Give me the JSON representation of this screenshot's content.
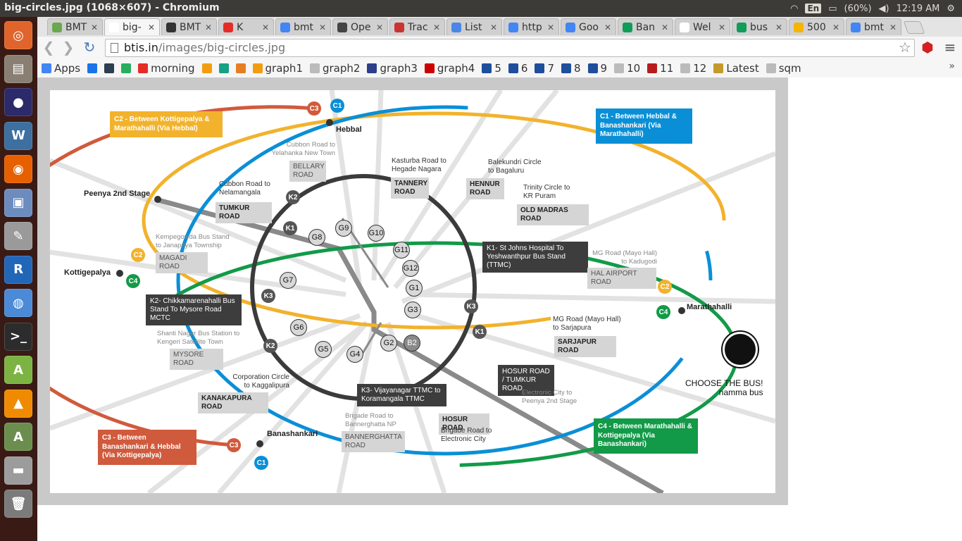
{
  "window": {
    "title": "big-circles.jpg (1068×607) - Chromium",
    "tray": {
      "lang": "En",
      "battery": "(60%)",
      "time": "12:19 AM"
    }
  },
  "launcher": {
    "items": [
      {
        "name": "ubuntu",
        "glyph": "◎",
        "color": "#e0642b"
      },
      {
        "name": "files",
        "glyph": "▤",
        "color": "#8a7f73"
      },
      {
        "name": "eclipse",
        "glyph": "●",
        "color": "#2c2a6b"
      },
      {
        "name": "mysql-workbench",
        "glyph": "W",
        "color": "#3d6fa0"
      },
      {
        "name": "firefox",
        "glyph": "◉",
        "color": "#e66000"
      },
      {
        "name": "image-viewer",
        "glyph": "▣",
        "color": "#6c8cbf"
      },
      {
        "name": "text-editor",
        "glyph": "✎",
        "color": "#9a9a9a"
      },
      {
        "name": "r",
        "glyph": "R",
        "color": "#2266b8"
      },
      {
        "name": "chromium",
        "glyph": "◍",
        "color": "#4a8ad6"
      },
      {
        "name": "terminal",
        "glyph": ">_",
        "color": "#2c2c2c"
      },
      {
        "name": "android-studio",
        "glyph": "A",
        "color": "#7cb342"
      },
      {
        "name": "vlc",
        "glyph": "▲",
        "color": "#f08a00"
      },
      {
        "name": "software-updater",
        "glyph": "A",
        "color": "#6b8e4e"
      },
      {
        "name": "disk",
        "glyph": "▬",
        "color": "#9c9c9c"
      },
      {
        "name": "trash",
        "glyph": "🗑",
        "color": "#7b7b7b"
      }
    ]
  },
  "browser": {
    "tabs": [
      {
        "label": "BMT",
        "fav": "#6aa84f",
        "active": false
      },
      {
        "label": "big-",
        "fav": "#ffffff",
        "active": true
      },
      {
        "label": "BMT",
        "fav": "#333333",
        "active": false
      },
      {
        "label": "K",
        "fav": "#e52d27",
        "active": false
      },
      {
        "label": "bmt",
        "fav": "#4285f4",
        "active": false
      },
      {
        "label": "Ope",
        "fav": "#444444",
        "active": false
      },
      {
        "label": "Trac",
        "fav": "#cc3333",
        "active": false
      },
      {
        "label": "List",
        "fav": "#4a86e8",
        "active": false
      },
      {
        "label": "http",
        "fav": "#4285f4",
        "active": false
      },
      {
        "label": "Goo",
        "fav": "#4285f4",
        "active": false
      },
      {
        "label": "Ban",
        "fav": "#0f9d58",
        "active": false
      },
      {
        "label": "Wel",
        "fav": "#ffffff",
        "active": false
      },
      {
        "label": "bus",
        "fav": "#0f9d58",
        "active": false
      },
      {
        "label": "500",
        "fav": "#f4b400",
        "active": false
      },
      {
        "label": "bmt",
        "fav": "#4285f4",
        "active": false
      }
    ],
    "url": {
      "host": "btis.in",
      "path": "/images/big-circles.jpg"
    },
    "bookmarks": [
      {
        "label": "Apps",
        "color": "#4285f4"
      },
      {
        "label": "",
        "color": "#1a73e8"
      },
      {
        "label": "",
        "color": "#2c3e50"
      },
      {
        "label": "",
        "color": "#27ae60"
      },
      {
        "label": "morning",
        "color": "#e52d27"
      },
      {
        "label": "",
        "color": "#f39c12"
      },
      {
        "label": "",
        "color": "#16a085"
      },
      {
        "label": "",
        "color": "#e67e22"
      },
      {
        "label": "graph1",
        "color": "#f39c12"
      },
      {
        "label": "graph2",
        "color": "#bbbbbb"
      },
      {
        "label": "graph3",
        "color": "#2c3e8a"
      },
      {
        "label": "graph4",
        "color": "#cc0000"
      },
      {
        "label": "5",
        "color": "#1f4e9c"
      },
      {
        "label": "6",
        "color": "#1f4e9c"
      },
      {
        "label": "7",
        "color": "#1f4e9c"
      },
      {
        "label": "8",
        "color": "#1f4e9c"
      },
      {
        "label": "9",
        "color": "#1f4e9c"
      },
      {
        "label": "10",
        "color": "#bbbbbb"
      },
      {
        "label": "11",
        "color": "#b71c1c"
      },
      {
        "label": "12",
        "color": "#bbbbbb"
      },
      {
        "label": "Latest",
        "color": "#c49a2c"
      },
      {
        "label": "sqm",
        "color": "#bbbbbb"
      }
    ]
  },
  "map": {
    "colors": {
      "c1": "#0a8fd6",
      "c2": "#f2b22c",
      "c3": "#d05a3c",
      "c4": "#129a48",
      "k": "#3b3b3b",
      "grey": "#8a8a8a"
    },
    "places": {
      "hebbal": "Hebbal",
      "peenya": "Peenya 2nd Stage",
      "kottigepalya": "Kottigepalya",
      "marathahalli": "Marathahalli",
      "banashankari": "Banashankari"
    },
    "callouts": {
      "c2": "C2 - Between Kottigepalya & Marathahalli (Via Hebbal)",
      "c1": "C1 - Between Hebbal & Banashankari (Via Marathahalli)",
      "c3": "C3 - Between Banashankari & Hebbal (Via Kottigepalya)",
      "c4": "C4 - Between Marathahalli & Kottigepalya (Via Banashankari)"
    },
    "labels": {
      "cubbon_yel": "Cubbon Road to Yelahanka New Town",
      "bellary": "BELLARY ROAD",
      "kasturba": "Kasturba Road to Hegade Nagara",
      "tannery": "TANNERY ROAD",
      "balekundri": "Balekundri Circle to Bagaluru",
      "hennur": "HENNUR ROAD",
      "trinity": "Trinity Circle to KR Puram",
      "old_madras": "OLD MADRAS ROAD",
      "cubbon_nel": "Cubbon Road to Nelamangala",
      "tumkur": "TUMKUR ROAD",
      "kempegowda": "Kempegowda Bus Stand to Janapriya Township",
      "magadi": "MAGADI ROAD",
      "k1": "K1- St Johns Hospital To Yeshwanthpur Bus Stand (TTMC)",
      "mg_kad": "MG Road (Mayo Hall) to Kadugodi",
      "hal": "HAL AIRPORT ROAD",
      "k2": "K2- Chikkamarenahalli Bus Stand To Mysore Road MCTC",
      "shanti": "Shanti Nagar Bus Station to Kengeri Satellite Town",
      "mysore": "MYSORE ROAD",
      "mg_sar": "MG Road (Mayo Hall) to Sarjapura",
      "sarjapur": "SARJAPUR ROAD",
      "hosur_tumkur": "HOSUR ROAD / TUMKUR ROAD",
      "electronic_peenya": "Electronic City to Peenya 2nd Stage",
      "corporation": "Corporation Circle to Kaggalipura",
      "kanakapura": "KANAKAPURA ROAD",
      "k3": "K3- Vijayanagar TTMC to Koramangala TTMC",
      "brigade_bann": "Brigade Road to Bannerghatta NP",
      "bannerghatta": "BANNERGHATTA ROAD",
      "hosur": "HOSUR ROAD",
      "brigade_elec": "Brigade Road to Electronic City"
    },
    "gnodes": [
      "G1",
      "G2",
      "G3",
      "G4",
      "G5",
      "G6",
      "G7",
      "G8",
      "G9",
      "G10",
      "G11",
      "G12",
      "B2"
    ],
    "knodes": [
      "K1",
      "K2",
      "K3"
    ],
    "cnodes": [
      "C1",
      "C2",
      "C3",
      "C4"
    ],
    "brand": {
      "line1": "CHOOSE THE BUS!",
      "line2": "namma bus"
    }
  }
}
